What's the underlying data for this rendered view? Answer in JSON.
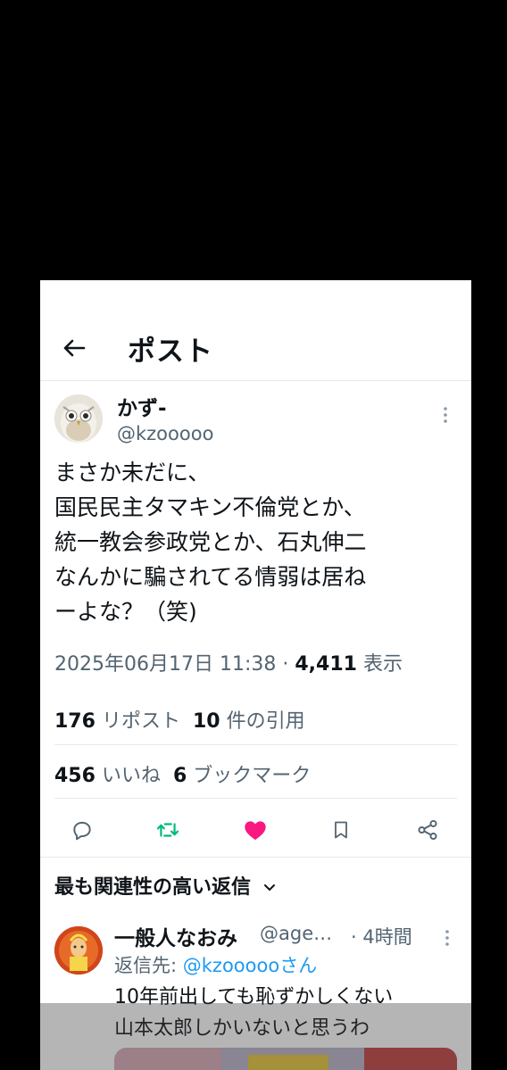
{
  "header": {
    "title": "ポスト",
    "back_icon": "arrow-left-icon"
  },
  "post": {
    "display_name": "かず-",
    "handle": "@kzooooo",
    "text": "まさか未だに、\n国民民主タマキン不倫党とか、\n統一教会参政党とか、石丸伸二\nなんかに騙されてる情弱は居ね\nーよな？（笑)",
    "timestamp": "2025年06月17日 11:38",
    "separator": "·",
    "views_count": "4,411",
    "views_label": "表示",
    "reposts_count": "176",
    "reposts_label": "リポスト",
    "quotes_count": "10",
    "quotes_label": "件の引用",
    "likes_count": "456",
    "likes_label": "いいね",
    "bookmarks_count": "6",
    "bookmarks_label": "ブックマーク"
  },
  "actions": [
    {
      "icon": "reply-icon"
    },
    {
      "icon": "repost-icon",
      "color": "#00ba7c"
    },
    {
      "icon": "heart-icon",
      "color": "#f91880"
    },
    {
      "icon": "bookmark-icon"
    },
    {
      "icon": "share-icon"
    }
  ],
  "replies_section": {
    "sort_label": "最も関連性の高い返信"
  },
  "reply": {
    "display_name": "一般人なおみ",
    "handle": "@age…",
    "time": "· 4時間",
    "reply_to_prefix": "返信先:",
    "reply_to_mention": "@kzooooo",
    "reply_to_suffix": "さん",
    "text": "10年前出しても恥ずかしくない\n山本太郎しかいないと思うわ"
  },
  "colors": {
    "accent": "#1d9bf0",
    "repost": "#00ba7c",
    "like": "#f91880",
    "muted": "#536471",
    "text": "#0f1419"
  }
}
